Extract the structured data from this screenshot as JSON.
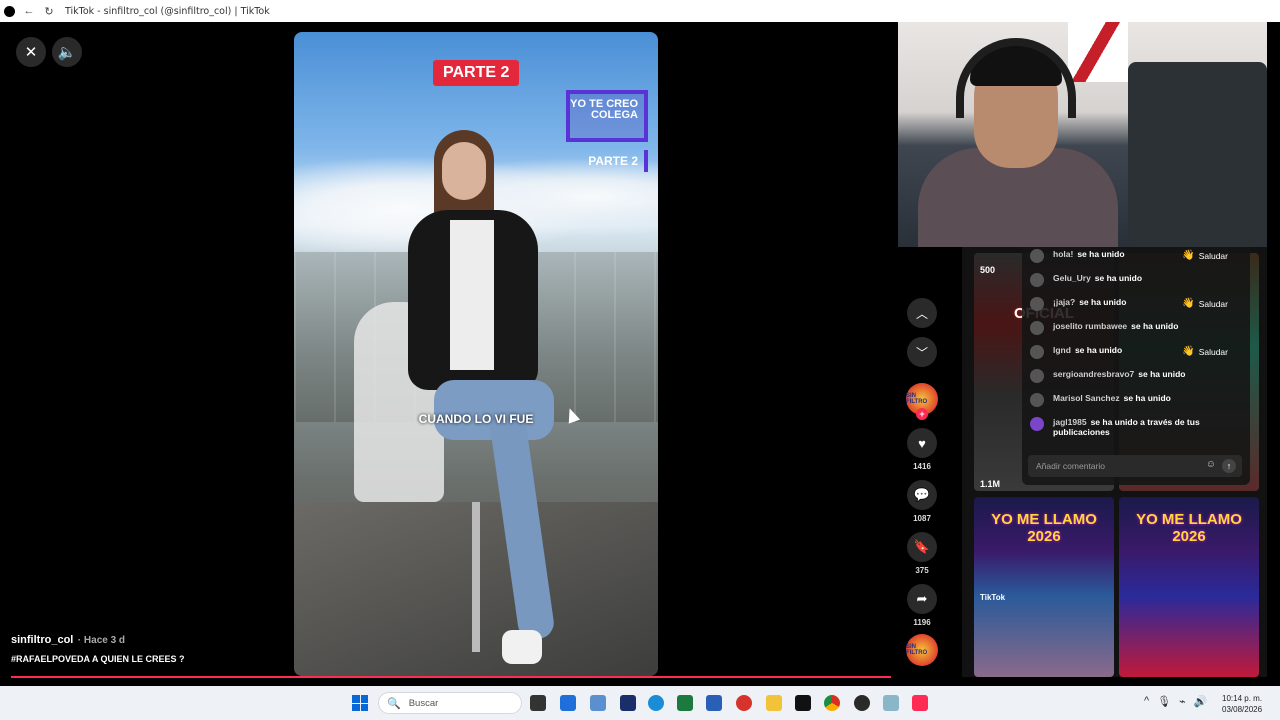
{
  "browser": {
    "tab_title": "TikTok - sinfiltro_col (@sinfiltro_col) | TikTok"
  },
  "video": {
    "overlay_parte": "PARTE 2",
    "overlay_yo_te_creo": "YO TE CREO COLEGA",
    "overlay_parte_small": "PARTE 2",
    "caption": "CUANDO LO VI FUE",
    "author": "sinfiltro_col",
    "time_ago": "· Hace 3 d",
    "description": "#RAFAELPOVEDA A QUIEN LE CREES ?"
  },
  "actions": {
    "likes": "1416",
    "comments": "1087",
    "saves": "375",
    "shares": "1196"
  },
  "side_grid": {
    "thumb1_views": "500",
    "thumb1_banner": "OFICIAL",
    "thumb2_views": "1.1M",
    "thumb3_banner": "YO ME LLAMO 2026",
    "thumb3_tag": "TikTok",
    "thumb4_banner": "YO ME LLAMO 2026"
  },
  "live_chat": {
    "joined_label": "se ha unido",
    "greet_label": "Saludar",
    "entries": [
      {
        "name": "hola!",
        "suffix": "se ha unido"
      },
      {
        "name": "Gelu_Ury",
        "suffix": "se ha unido"
      },
      {
        "name": "¡jaja?",
        "suffix": "se ha unido"
      },
      {
        "name": "joselito rumbawee",
        "suffix": "se ha unido"
      },
      {
        "name": "lgnd",
        "suffix": "se ha unido"
      },
      {
        "name": "sergioandresbravo7",
        "suffix": "se ha unido"
      },
      {
        "name": "Marisol Sanchez",
        "suffix": "se ha unido"
      },
      {
        "name": "jagl1985",
        "suffix": "se ha unido a través de tus publicaciones"
      }
    ],
    "input_placeholder": "Añadir comentario"
  },
  "taskbar": {
    "search_placeholder": "Buscar",
    "time": "10:14 p. m.",
    "date": "03/08/2026"
  },
  "colors": {
    "accent": "#fe2c55",
    "overlay_red": "#e3283c",
    "overlay_purple": "#5a33d6"
  }
}
